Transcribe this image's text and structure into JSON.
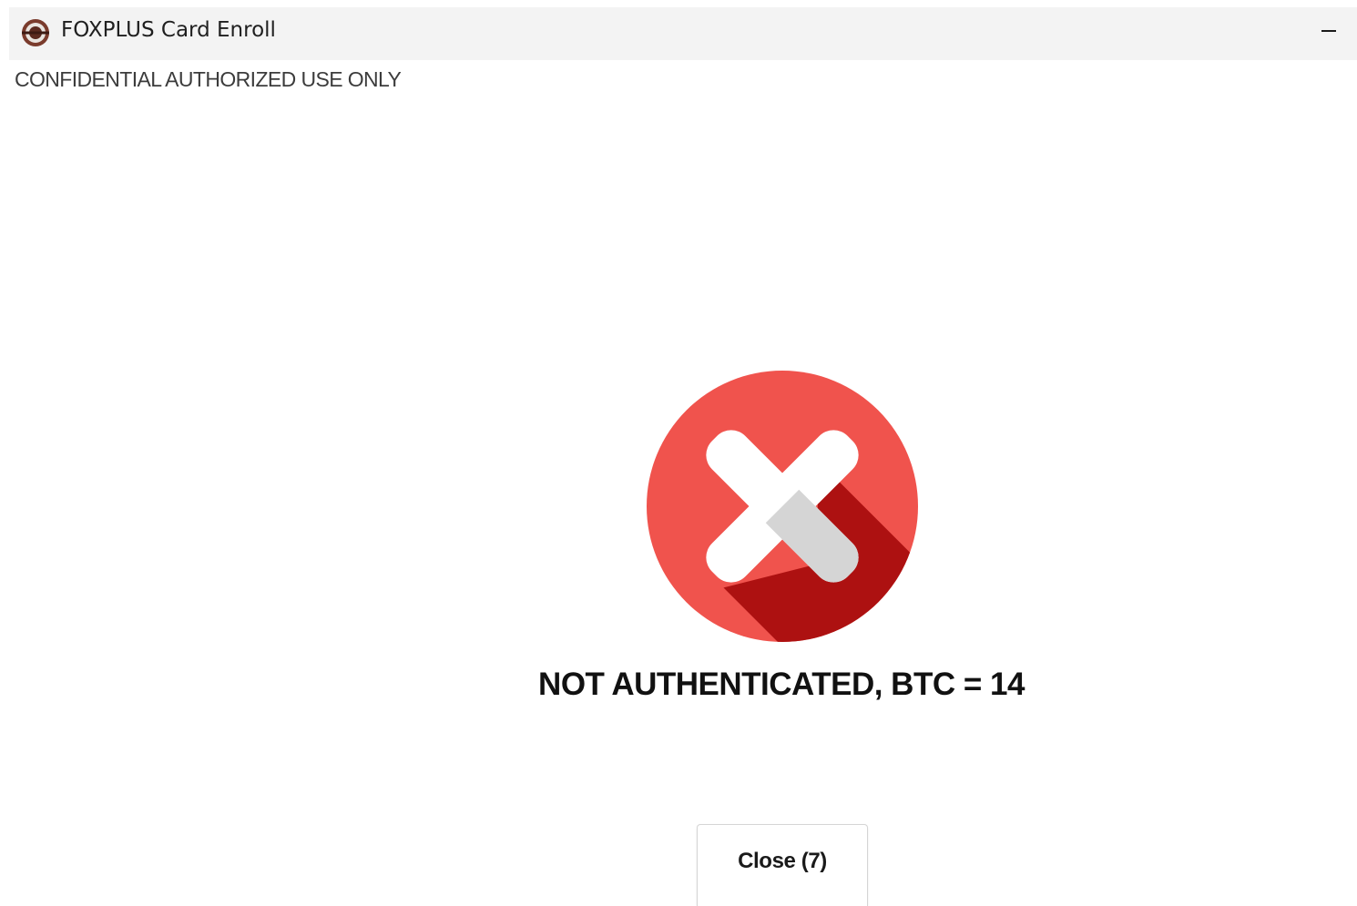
{
  "window": {
    "title": "FOXPLUS Card Enroll",
    "app_icon": "foxplus-app-icon",
    "minimize_icon": "minimize-icon"
  },
  "banner": {
    "text": "CONFIDENTIAL AUTHORIZED USE ONLY"
  },
  "result": {
    "icon": "error-x-icon",
    "message": "NOT AUTHENTICATED, BTC = 14",
    "colors": {
      "circle": "#f0534d",
      "shadow": "#ad1111",
      "cross": "#ffffff",
      "cross_shade": "#d5d5d5"
    }
  },
  "actions": {
    "close_label": "Close (7)"
  }
}
